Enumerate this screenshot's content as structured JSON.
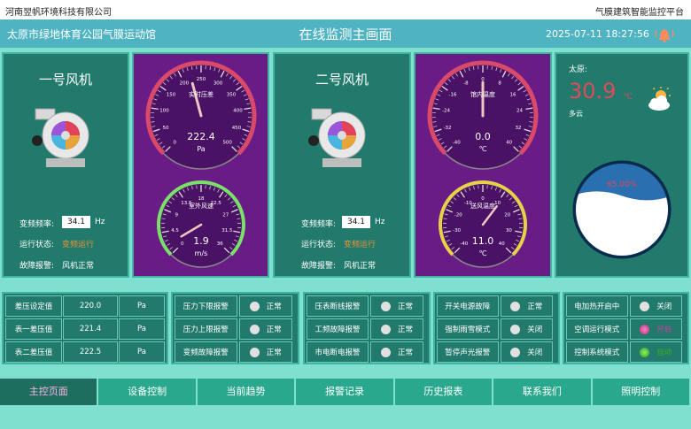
{
  "company": "河南翌帆环境科技有限公司",
  "platform": "气膜建筑智能监控平台",
  "header": {
    "venue": "太原市绿地体育公园气膜运动馆",
    "title": "在线监测主画面",
    "datetime": "2025-07-11 18:27:56",
    "bell_icon": "alarm-bell-icon"
  },
  "fan1": {
    "name": "一号风机",
    "freq_label": "变频频率:",
    "freq_value": "34.1",
    "freq_unit": "Hz",
    "state_label": "运行状态:",
    "state_value": "变频运行",
    "fault_label": "故障报警:",
    "fault_value": "风机正常"
  },
  "fan2": {
    "name": "二号风机",
    "freq_label": "变频频率:",
    "freq_value": "34.1",
    "freq_unit": "Hz",
    "state_label": "运行状态:",
    "state_value": "变频运行",
    "fault_label": "故障报警:",
    "fault_value": "风机正常"
  },
  "gauges": {
    "pressure": {
      "label": "实时压差",
      "value": "222.4",
      "unit": "Pa",
      "min": 0,
      "max": 500,
      "ticks": [
        "0",
        "50",
        "100",
        "150",
        "200",
        "250",
        "300",
        "350",
        "400",
        "450",
        "500"
      ]
    },
    "wind": {
      "label": "室外风速",
      "value": "1.9",
      "unit": "m/s",
      "min": 0,
      "max": 36,
      "ticks": [
        "0",
        "4.5",
        "9",
        "13.5",
        "18",
        "22.5",
        "27",
        "31.5",
        "36"
      ]
    },
    "indoor_temp": {
      "label": "馆内温度",
      "value": "0.0",
      "unit": "℃",
      "min": -40,
      "max": 40,
      "ticks": [
        "-40",
        "-32",
        "-24",
        "-16",
        "-8",
        "0",
        "8",
        "16",
        "24",
        "32",
        "40"
      ]
    },
    "supply_temp": {
      "label": "送风温度",
      "value": "11.0",
      "unit": "℃",
      "min": -40,
      "max": 40,
      "ticks": [
        "-40",
        "-30",
        "-20",
        "-10",
        "0",
        "10",
        "20",
        "30",
        "40"
      ]
    }
  },
  "weather": {
    "city": "太原:",
    "temp": "30.9",
    "unit": "℃",
    "desc": "多云",
    "humidity": "65.00%",
    "humidity_fraction": 0.65,
    "icon": "partly-cloudy-icon"
  },
  "pressure_table": [
    {
      "label": "差压设定值",
      "value": "220.0",
      "unit": "Pa"
    },
    {
      "label": "表一差压值",
      "value": "221.4",
      "unit": "Pa"
    },
    {
      "label": "表二差压值",
      "value": "222.5",
      "unit": "Pa"
    }
  ],
  "alarm_table_1": [
    {
      "label": "压力下限报警",
      "status": "正常"
    },
    {
      "label": "压力上限报警",
      "status": "正常"
    },
    {
      "label": "变频故障报警",
      "status": "正常"
    }
  ],
  "alarm_table_2": [
    {
      "label": "压表断线报警",
      "status": "正常"
    },
    {
      "label": "工频故障报警",
      "status": "正常"
    },
    {
      "label": "市电断电报警",
      "status": "正常"
    }
  ],
  "alarm_table_3": [
    {
      "label": "开关电源故障",
      "status": "正常"
    },
    {
      "label": "强制雨雪模式",
      "status": "关闭"
    },
    {
      "label": "暂停声光报警",
      "status": "关闭"
    }
  ],
  "mode_table": [
    {
      "label": "电加热开启中",
      "status": "关闭",
      "dot": "gray"
    },
    {
      "label": "空调运行模式",
      "status": "开启",
      "dot": "pink"
    },
    {
      "label": "控制系统模式",
      "status": "自动",
      "dot": "green"
    }
  ],
  "colors": {
    "teal_dark": "#217a6c",
    "purple": "#6a1c86",
    "status_orange": "#e8943a",
    "pink": "#c2409a",
    "green": "#3fae22"
  },
  "nav": [
    "主控页面",
    "设备控制",
    "当前趋势",
    "报警记录",
    "历史报表",
    "联系我们",
    "照明控制"
  ]
}
